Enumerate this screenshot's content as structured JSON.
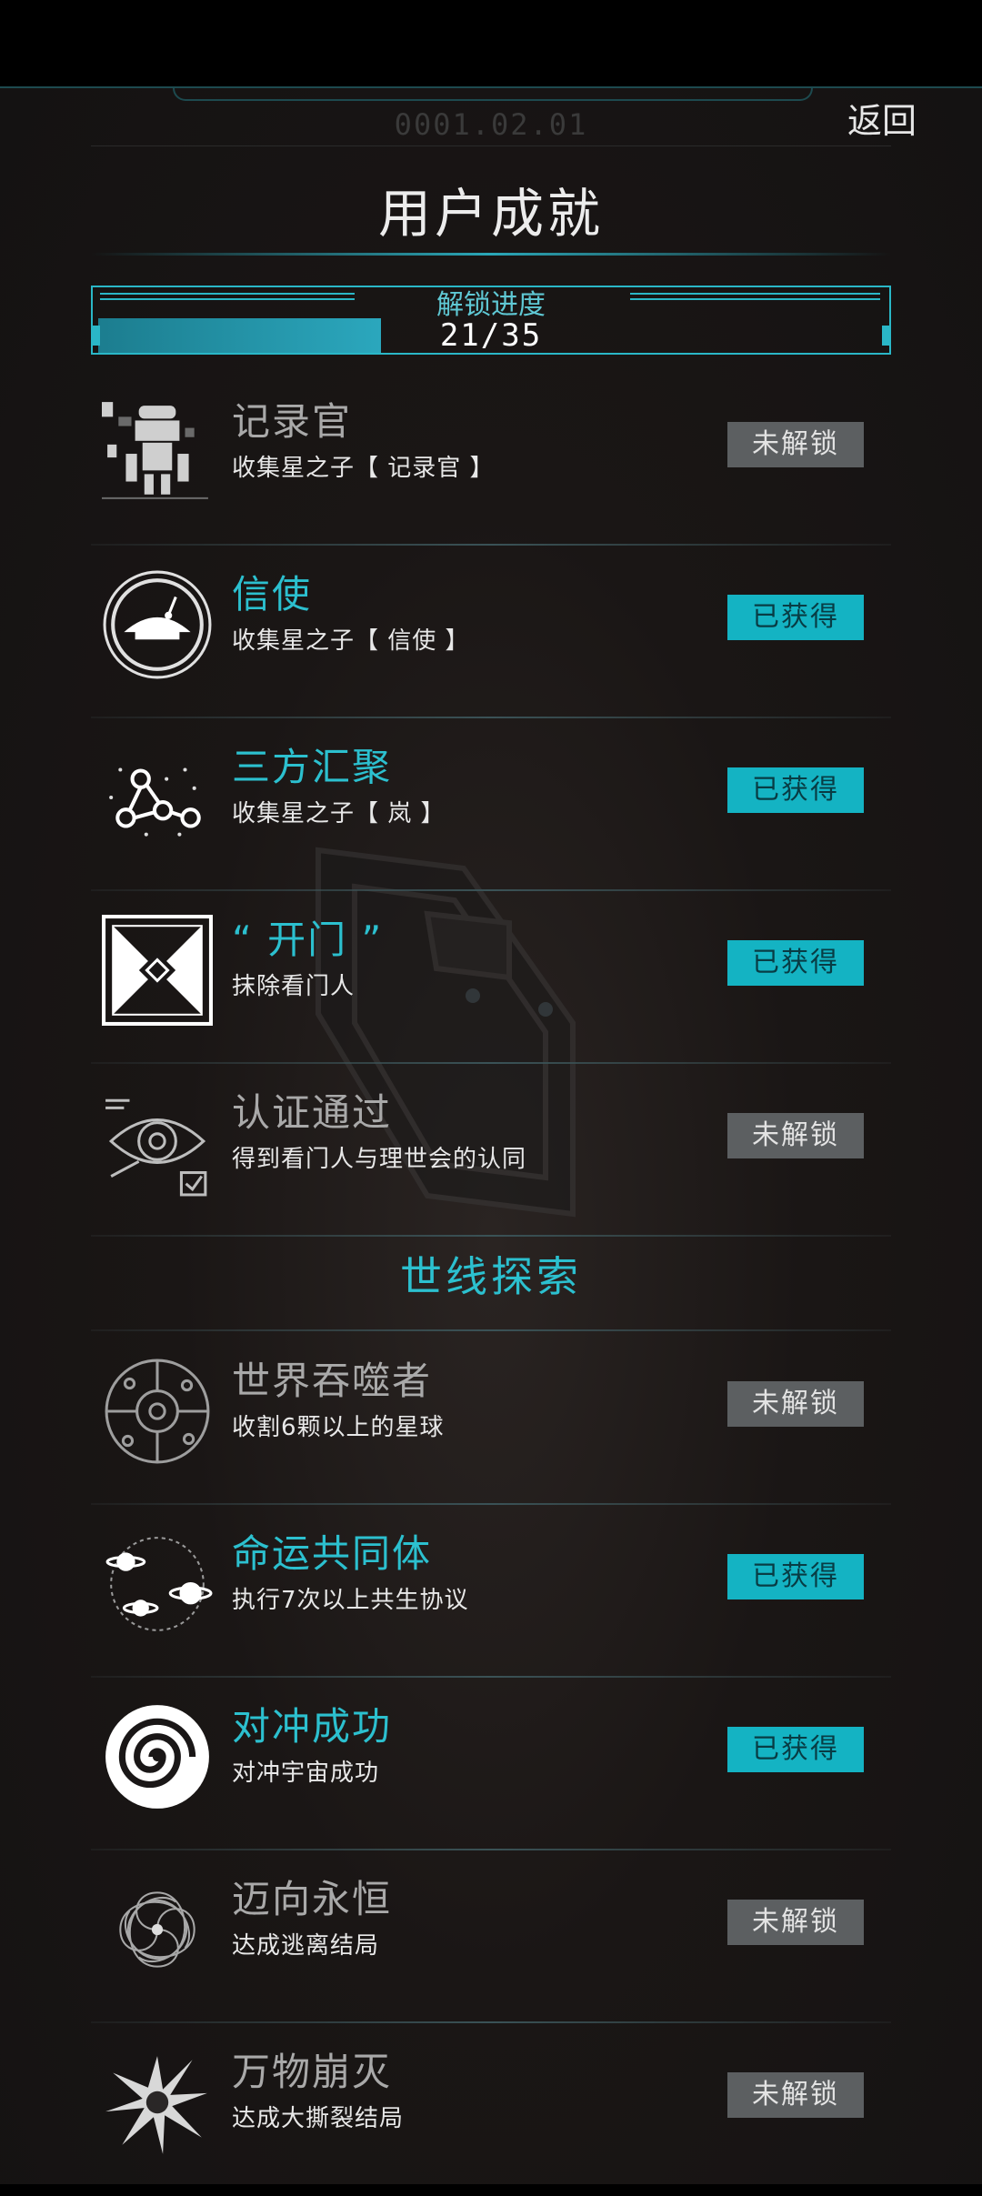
{
  "header": {
    "date": "0001.02.01",
    "back_label": "返回",
    "title": "用户成就"
  },
  "progress": {
    "label": "解锁进度",
    "text": "21/35",
    "unlocked": 21,
    "total": 35
  },
  "achievements_primary": [
    {
      "name": "记录官",
      "desc": "收集星之子【 记录官 】",
      "status": "未解锁",
      "obtained": false,
      "icon": "robot-icon"
    },
    {
      "name": "信使",
      "desc": "收集星之子【 信使 】",
      "status": "已获得",
      "obtained": true,
      "icon": "ship-emblem-icon"
    },
    {
      "name": "三方汇聚",
      "desc": "收集星之子【 岚 】",
      "status": "已获得",
      "obtained": true,
      "icon": "constellation-icon"
    },
    {
      "name": "“ 开门 ”",
      "desc": "抹除看门人",
      "status": "已获得",
      "obtained": true,
      "icon": "gate-icon"
    },
    {
      "name": "认证通过",
      "desc": "得到看门人与理世会的认同",
      "status": "未解锁",
      "obtained": false,
      "icon": "eye-scan-icon"
    }
  ],
  "section_title": "世线探索",
  "achievements_world": [
    {
      "name": "世界吞噬者",
      "desc": "收割6颗以上的星球",
      "status": "未解锁",
      "obtained": false,
      "icon": "planet-network-icon"
    },
    {
      "name": "命运共同体",
      "desc": "执行7次以上共生协议",
      "status": "已获得",
      "obtained": true,
      "icon": "orbit-planets-icon"
    },
    {
      "name": "对冲成功",
      "desc": "对冲宇宙成功",
      "status": "已获得",
      "obtained": true,
      "icon": "spiral-icon"
    },
    {
      "name": "迈向永恒",
      "desc": "达成逃离结局",
      "status": "未解锁",
      "obtained": false,
      "icon": "vortex-icon"
    },
    {
      "name": "万物崩灭",
      "desc": "达成大撕裂结局",
      "status": "未解锁",
      "obtained": false,
      "icon": "burst-icon"
    }
  ],
  "colors": {
    "accent": "#2cc0cf",
    "obtained_button": "#14b3c3",
    "locked_button": "#5c5f61"
  }
}
